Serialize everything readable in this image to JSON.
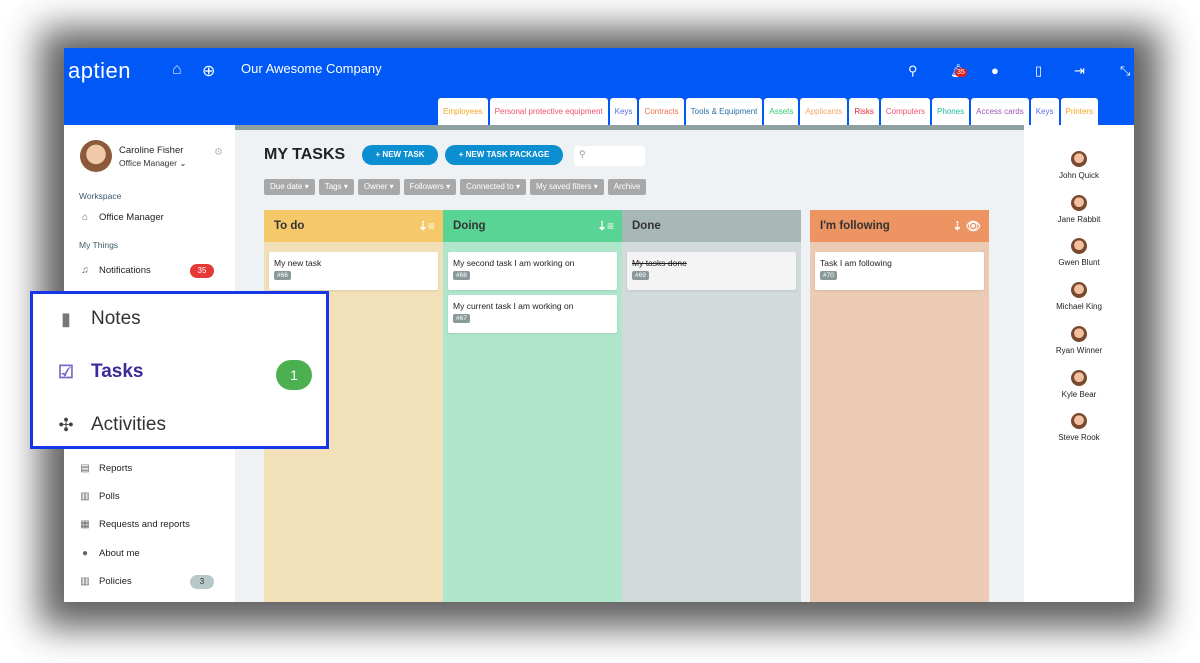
{
  "header": {
    "logo": "aptien",
    "company": "Our Awesome Company",
    "notification_count": "35"
  },
  "tabs": [
    {
      "label": "Employees",
      "color": "#f5a623"
    },
    {
      "label": "Personal protective equipment",
      "color": "#f0506e"
    },
    {
      "label": "Keys",
      "color": "#5b6ee1"
    },
    {
      "label": "Contracts",
      "color": "#f07050"
    },
    {
      "label": "Tools & Equipment",
      "color": "#2a6fa8"
    },
    {
      "label": "Assets",
      "color": "#2ecc71"
    },
    {
      "label": "Applicants",
      "color": "#f5a860"
    },
    {
      "label": "Risks",
      "color": "#e8283c"
    },
    {
      "label": "Computers",
      "color": "#f0506e"
    },
    {
      "label": "Phones",
      "color": "#1abc9c"
    },
    {
      "label": "Access cards",
      "color": "#9b59b6"
    },
    {
      "label": "Keys",
      "color": "#5b6ee1"
    },
    {
      "label": "Printers",
      "color": "#f5a623"
    }
  ],
  "user": {
    "name": "Caroline Fisher",
    "role": "Office Manager"
  },
  "sidebar": {
    "workspace_label": "Workspace",
    "workspace_item": "Office Manager",
    "mythings_label": "My Things",
    "notifications": {
      "label": "Notifications",
      "badge": "35"
    },
    "items": [
      {
        "label": "Reports"
      },
      {
        "label": "Polls"
      },
      {
        "label": "Requests and reports"
      },
      {
        "label": "About me"
      },
      {
        "label": "Policies",
        "badge": "3"
      }
    ]
  },
  "callout": {
    "items": [
      {
        "label": "Notes"
      },
      {
        "label": "Tasks",
        "badge": "1"
      },
      {
        "label": "Activities"
      }
    ]
  },
  "main": {
    "title": "MY TASKS",
    "new_task": "+ NEW TASK",
    "new_package": "+ NEW TASK PACKAGE",
    "filters": [
      "Due date ▾",
      "Tags ▾",
      "Owner ▾",
      "Followers ▾",
      "Connected to ▾",
      "My saved filters ▾",
      "Archive"
    ]
  },
  "columns": [
    {
      "title": "To do",
      "header_color": "#f5c86a",
      "body_color": "#f1e0b8",
      "cards": [
        {
          "title": "My new task",
          "id": "#66"
        }
      ]
    },
    {
      "title": "Doing",
      "header_color": "#5ad494",
      "body_color": "#b0e6cc",
      "cards": [
        {
          "title": "My second task I am working on",
          "id": "#68"
        },
        {
          "title": "My current task I am working on",
          "id": "#67"
        }
      ]
    },
    {
      "title": "Done",
      "header_color": "#a8b8b6",
      "body_color": "#d2dadc",
      "cards": [
        {
          "title": "My tasks done",
          "id": "#69"
        }
      ]
    },
    {
      "title": "I'm following",
      "header_color": "#ec9462",
      "body_color": "#eccbb4",
      "cards": [
        {
          "title": "Task I am following",
          "id": "#70"
        }
      ]
    }
  ],
  "people": [
    "John Quick",
    "Jane Rabbit",
    "Gwen Blunt",
    "Michael King",
    "Ryan Winner",
    "Kyle Bear",
    "Steve Rook"
  ]
}
